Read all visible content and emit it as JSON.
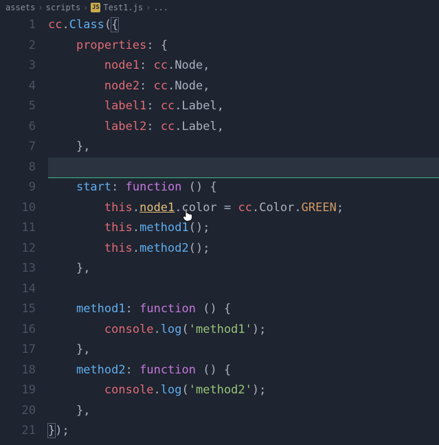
{
  "breadcrumb": {
    "seg1": "assets",
    "seg2": "scripts",
    "file_icon": "JS",
    "seg3": "Test1.js",
    "seg4": "..."
  },
  "line_numbers": [
    "1",
    "2",
    "3",
    "4",
    "5",
    "6",
    "7",
    "8",
    "9",
    "10",
    "11",
    "12",
    "13",
    "14",
    "15",
    "16",
    "17",
    "18",
    "19",
    "20",
    "21"
  ],
  "tok": {
    "cc": "cc",
    "Class": "Class",
    "properties": "properties",
    "node1k": "node1",
    "node2k": "node2",
    "label1k": "label1",
    "label2k": "label2",
    "Node": "Node",
    "Label": "Label",
    "start": "start",
    "function": "function",
    "this": "this",
    "node1m": "node1",
    "color": "color",
    "Color": "Color",
    "GREEN": "GREEN",
    "method1": "method1",
    "method2": "method2",
    "console": "console",
    "log": "log",
    "str_method1": "'method1'",
    "str_method2": "'method2'",
    "dot": ".",
    "colon": ":",
    "comma": ",",
    "semi": ";",
    "eq": "=",
    "lparen": "(",
    "rparen": ")",
    "lbrace": "{",
    "rbrace": "}",
    "lbracem": "{",
    "rbracem": "}",
    "emptyparens": "()",
    "sp": " "
  }
}
